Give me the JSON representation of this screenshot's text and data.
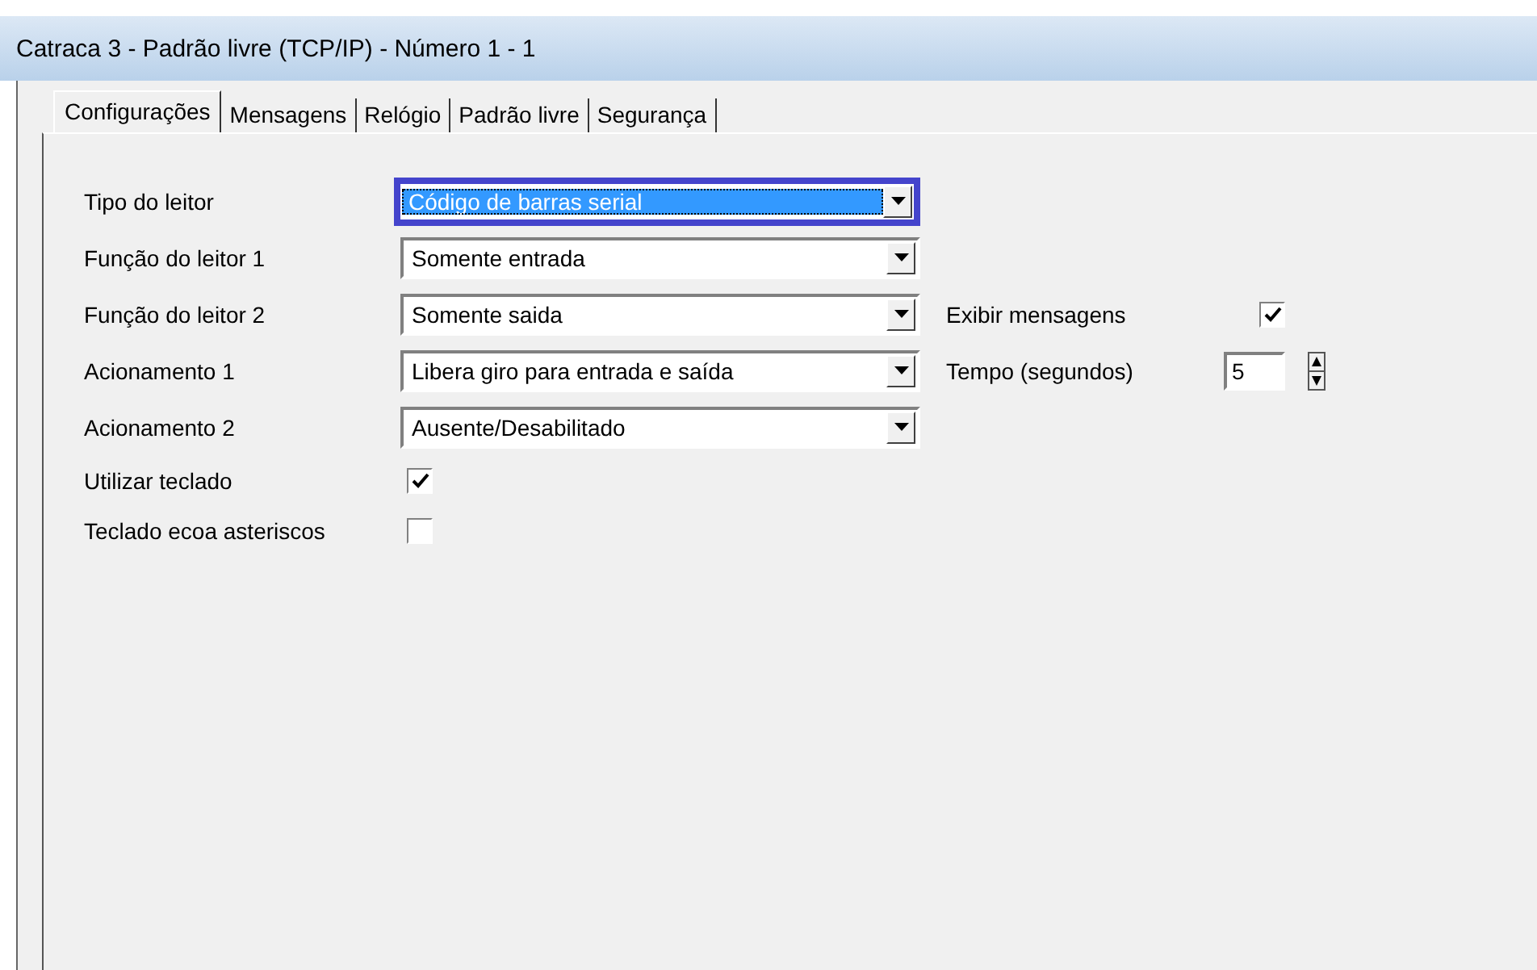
{
  "window": {
    "title": "Catraca 3 - Padrão livre (TCP/IP) - Número 1 - 1"
  },
  "tabs": [
    {
      "label": "Configurações",
      "selected": true
    },
    {
      "label": "Mensagens",
      "selected": false
    },
    {
      "label": "Relógio",
      "selected": false
    },
    {
      "label": "Padrão livre",
      "selected": false
    },
    {
      "label": "Segurança",
      "selected": false
    }
  ],
  "fields": [
    {
      "kind": "combo",
      "label": "Tipo do leitor",
      "value": "Código de barras serial",
      "focused": true
    },
    {
      "kind": "combo",
      "label": "Função do leitor 1",
      "value": "Somente entrada",
      "focused": false
    },
    {
      "kind": "combo",
      "label": "Função do leitor 2",
      "value": "Somente saida",
      "focused": false,
      "side": {
        "kind": "checkbox",
        "label": "Exibir mensagens",
        "checked": true
      }
    },
    {
      "kind": "combo",
      "label": "Acionamento 1",
      "value": "Libera giro para entrada e saída",
      "focused": false,
      "side": {
        "kind": "spin",
        "label": "Tempo (segundos)",
        "value": "5"
      }
    },
    {
      "kind": "combo",
      "label": "Acionamento 2",
      "value": "Ausente/Desabilitado",
      "focused": false
    },
    {
      "kind": "checkbox",
      "label": "Utilizar teclado",
      "checked": true
    },
    {
      "kind": "checkbox",
      "label": "Teclado ecoa asteriscos",
      "checked": false
    }
  ]
}
